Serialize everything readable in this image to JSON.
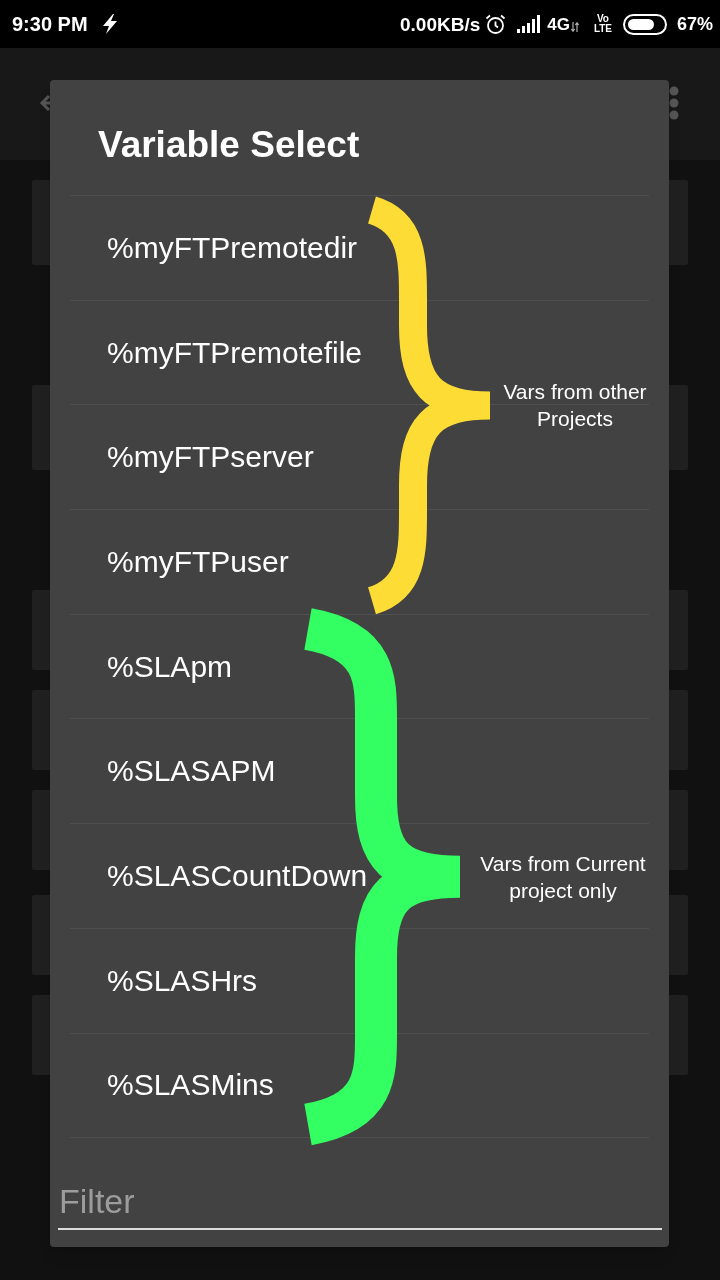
{
  "status_bar": {
    "time": "9:30 PM",
    "speed": "0.00KB/s",
    "network": "4G",
    "volte": "Vo LTE",
    "battery": "67%"
  },
  "dialog": {
    "title": "Variable Select",
    "groups": [
      {
        "items": [
          "%myFTPremotedir",
          "%myFTPremotefile",
          "%myFTPserver",
          "%myFTPuser"
        ],
        "annotation": {
          "text": "Vars from other Projects",
          "color": "#fddc36"
        }
      },
      {
        "items": [
          "%SLApm",
          "%SLASAPM",
          "%SLASCountDown",
          "%SLASHrs",
          "%SLASMins"
        ],
        "annotation": {
          "text": "Vars from Current project only",
          "color": "#34ff62"
        }
      }
    ],
    "filter": {
      "placeholder": "Filter"
    }
  }
}
